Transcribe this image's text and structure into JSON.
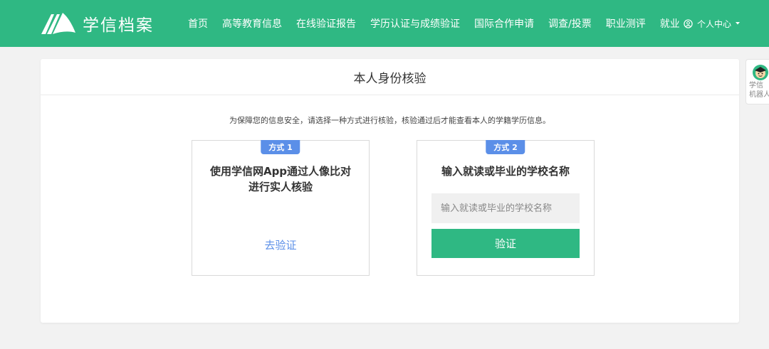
{
  "header": {
    "logo_text": "学信档案",
    "nav": [
      "首页",
      "高等教育信息",
      "在线验证报告",
      "学历认证与成绩验证",
      "国际合作申请",
      "调查/投票",
      "职业测评",
      "就业"
    ],
    "user_menu": "个人中心"
  },
  "panel": {
    "title": "本人身份核验",
    "notice": "为保障您的信息安全，请选择一种方式进行核验，核验通过后才能查看本人的学籍学历信息。",
    "method1": {
      "badge": "方式 1",
      "heading_line1": "使用学信网App通过人像比对",
      "heading_line2": "进行实人核验",
      "link": "去验证"
    },
    "method2": {
      "badge": "方式 2",
      "heading": "输入就读或毕业的学校名称",
      "placeholder": "输入就读或毕业的学校名称",
      "button": "验证"
    }
  },
  "robot": {
    "line1": "学信",
    "line2": "机器人"
  },
  "colors": {
    "brand_green": "#2fb883",
    "badge_blue": "#5b8fe8"
  }
}
